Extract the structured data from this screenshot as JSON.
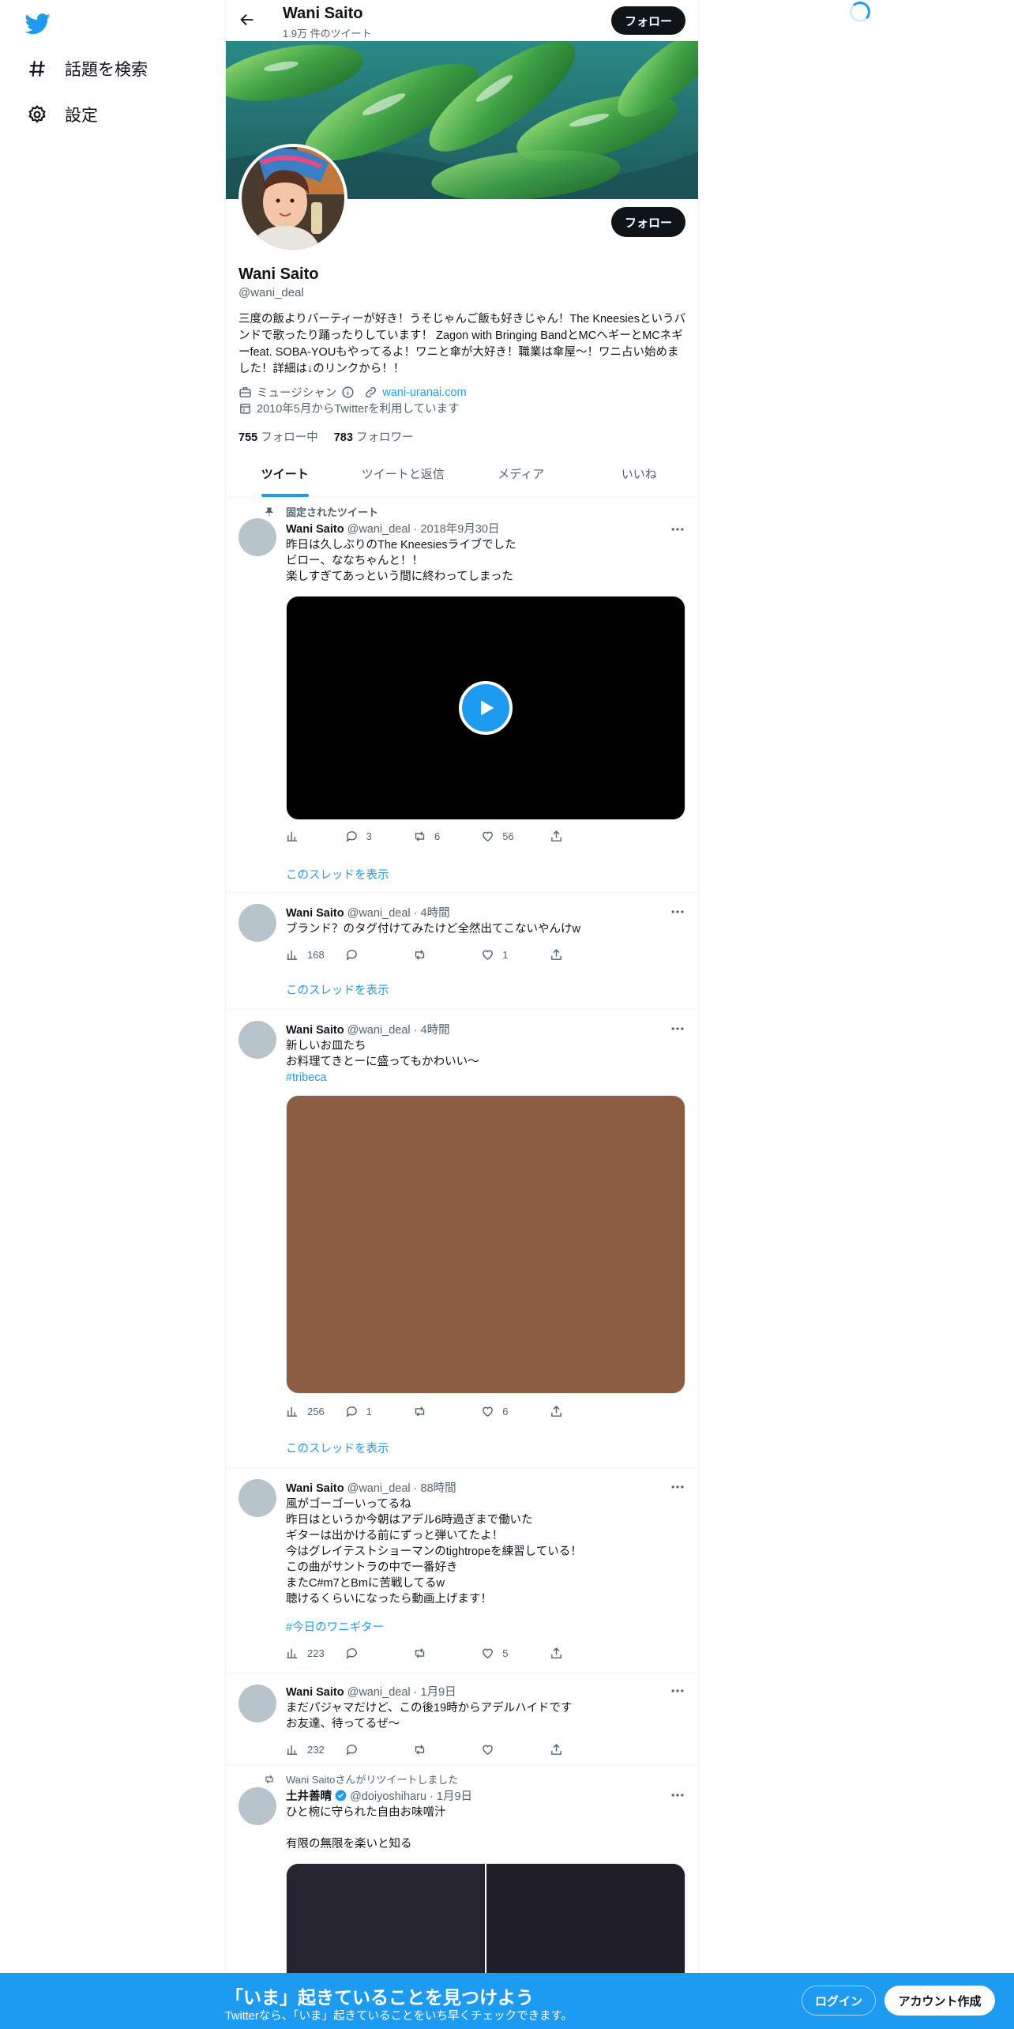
{
  "nav": {
    "explore_label": "話題を検索",
    "settings_label": "設定"
  },
  "topbar": {
    "name": "Wani Saito",
    "tweet_count": "1.9万 件のツイート",
    "follow_label": "フォロー"
  },
  "profile": {
    "name": "Wani Saito",
    "handle": "@wani_deal",
    "follow_label": "フォロー",
    "bio": "三度の飯よりパーティーが好き！うそじゃんご飯も好きじゃん！The Kneesiesというバンドで歌ったり踊ったりしています！ Zagon with Bringing BandとMCヘギーとMCネギーfeat. SOBA-YOUもやってるよ！ワニと傘が大好き！職業は傘屋〜！ワニ占い始めました！詳細は↓のリンクから！！",
    "category": "ミュージシャン",
    "url": "wani-uranai.com",
    "joined": "2010年5月からTwitterを利用しています",
    "following_count": "755",
    "following_label": "フォロー中",
    "followers_count": "783",
    "followers_label": "フォロワー"
  },
  "tabs": [
    {
      "label": "ツイート",
      "active": true
    },
    {
      "label": "ツイートと返信",
      "active": false
    },
    {
      "label": "メディア",
      "active": false
    },
    {
      "label": "いいね",
      "active": false
    }
  ],
  "tweets": [
    {
      "pinned_label": "固定されたツイート",
      "name": "Wani Saito",
      "handle": "@wani_deal",
      "time": "2018年9月30日",
      "text": "昨日は久しぶりのThe Kneesiesライブでした\nビロー、ななちゃんと！！\n楽しすぎてあっという間に終わってしまった",
      "views": "",
      "replies": "3",
      "retweets": "6",
      "likes": "56",
      "thread_label": "このスレッドを表示"
    },
    {
      "name": "Wani Saito",
      "handle": "@wani_deal",
      "time": "4時間",
      "text": "ブランド？のタグ付けてみたけど全然出てこないやんけw",
      "views": "168",
      "replies": "",
      "retweets": "",
      "likes": "1",
      "thread_label": "このスレッドを表示"
    },
    {
      "name": "Wani Saito",
      "handle": "@wani_deal",
      "time": "4時間",
      "text": "新しいお皿たち\nお料理てきとーに盛ってもかわいい〜",
      "hashtag": "#tribeca",
      "media_color": "#8b5e43",
      "views": "256",
      "replies": "1",
      "retweets": "",
      "likes": "6",
      "thread_label": "このスレッドを表示"
    },
    {
      "name": "Wani Saito",
      "handle": "@wani_deal",
      "time": "88時間",
      "text": "風がゴーゴーいってるね\n昨日はというか今朝はアデル6時過ぎまで働いた\nギターは出かける前にずっと弾いてたよ！\n今はグレイテストショーマンのtightropeを練習している！\nこの曲がサントラの中で一番好き\nまたC#m7とBmに苦戦してるw\n聴けるくらいになったら動画上げます！",
      "hashtag": "#今日のワニギター",
      "views": "223",
      "replies": "",
      "retweets": "",
      "likes": "5"
    },
    {
      "name": "Wani Saito",
      "handle": "@wani_deal",
      "time": "1月9日",
      "text": "まだパジャマだけど、この後19時からアデルハイドです\nお友達、待ってるぜ〜",
      "views": "232",
      "replies": "",
      "retweets": "",
      "likes": ""
    },
    {
      "retweet_label": "Wani Saitoさんがリツイートしました",
      "name": "土井善晴",
      "handle": "@doiyoshiharu",
      "time": "1月9日",
      "text": "ひと椀に守られた自由お味噌汁\n\n有限の無限を楽いと知る"
    }
  ],
  "bottombar": {
    "title": "「いま」起きていることを見つけよう",
    "subtitle": "Twitterなら、「いま」起きていることをいち早くチェックできます。",
    "login_label": "ログイン",
    "signup_label": "アカウント作成"
  },
  "colors": {
    "accent": "#1d9bf0",
    "bottombar": "#1d9bf0"
  }
}
